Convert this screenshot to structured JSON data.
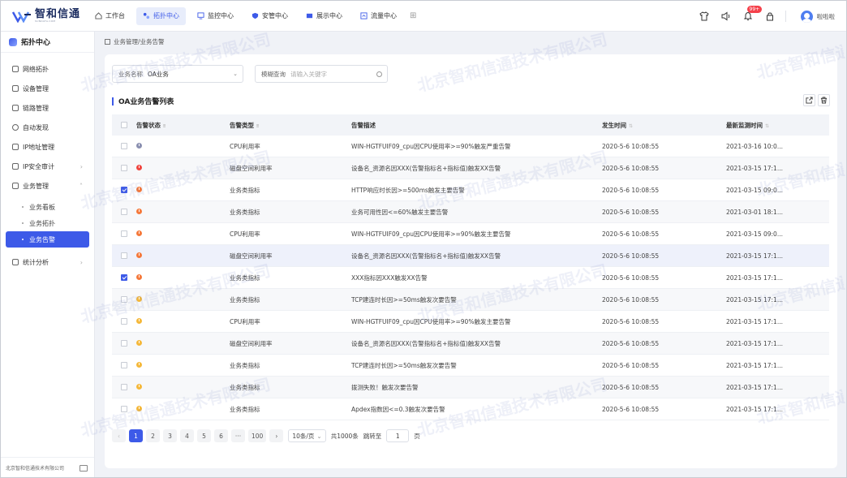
{
  "brand": {
    "name": "智和信通",
    "subtitle": "SUNDATA.COM"
  },
  "nav": [
    {
      "label": "工作台",
      "active": false
    },
    {
      "label": "拓扑中心",
      "active": true
    },
    {
      "label": "监控中心",
      "active": false
    },
    {
      "label": "安管中心",
      "active": false
    },
    {
      "label": "展示中心",
      "active": false
    },
    {
      "label": "流量中心",
      "active": false
    }
  ],
  "header": {
    "notification_count": "99+",
    "user_name": "啦啦啦"
  },
  "sidebar": {
    "title": "拓扑中心",
    "items": [
      {
        "label": "网络拓扑"
      },
      {
        "label": "设备管理"
      },
      {
        "label": "链路管理"
      },
      {
        "label": "自动发现"
      },
      {
        "label": "IP地址管理"
      },
      {
        "label": "IP安全审计"
      },
      {
        "label": "业务管理"
      }
    ],
    "subitems": [
      {
        "label": "业务看板",
        "active": false
      },
      {
        "label": "业务拓扑",
        "active": false
      },
      {
        "label": "业务告警",
        "active": true
      }
    ],
    "after": {
      "label": "统计分析"
    },
    "footer": "北京智和信通技术有限公司"
  },
  "breadcrumb": "业务管理/业务告警",
  "filters": {
    "biz_label": "业务名称",
    "biz_value": "OA业务",
    "search_label": "模糊查询",
    "search_placeholder": "请输入关键字"
  },
  "section_title": "OA业务告警列表",
  "table": {
    "headers": [
      "告警状态",
      "告警类型",
      "告警描述",
      "发生时间",
      "最新监测时间"
    ],
    "rows": [
      {
        "checked": false,
        "sev": "#8a8fb0",
        "type": "CPU利用率",
        "desc": "WIN-HGTFUIF09_cpu因CPU使用率>=90%触发严重告警",
        "time": "2020-5-6 10:08:55",
        "latest": "2021-03-16 10:0..."
      },
      {
        "checked": false,
        "sev": "#f0453f",
        "type": "磁盘空间利用率",
        "desc": "设备名_资源名因XXX(告警指标名+指标值)触发XX告警",
        "time": "2020-5-6 10:08:55",
        "latest": "2021-03-15 17:1..."
      },
      {
        "checked": true,
        "sev": "#f5793b",
        "type": "业务类指标",
        "desc": "HTTP响应时长因>=500ms触发主要告警",
        "time": "2020-5-6 10:08:55",
        "latest": "2021-03-15 09:0..."
      },
      {
        "checked": false,
        "sev": "#f5793b",
        "type": "业务类指标",
        "desc": "业务可用性因<=60%触发主要告警",
        "time": "2020-5-6 10:08:55",
        "latest": "2021-03-01 18:1..."
      },
      {
        "checked": false,
        "sev": "#f5793b",
        "type": "CPU利用率",
        "desc": "WIN-HGTFUIF09_cpu因CPU使用率>=90%触发主要告警",
        "time": "2020-5-6 10:08:55",
        "latest": "2021-03-15 09:0..."
      },
      {
        "checked": false,
        "sev": "#f5793b",
        "type": "磁盘空间利用率",
        "desc": "设备名_资源名因XXX(告警指标名+指标值)触发XX告警",
        "time": "2020-5-6 10:08:55",
        "latest": "2021-03-15 17:1..."
      },
      {
        "checked": true,
        "sev": "#f5793b",
        "type": "业务类指标",
        "desc": "XXX指标因XXX触发XX告警",
        "time": "2020-5-6 10:08:55",
        "latest": "2021-03-15 17:1..."
      },
      {
        "checked": false,
        "sev": "#f5b83a",
        "type": "业务类指标",
        "desc": "TCP建连时长因>=50ms触发次要告警",
        "time": "2020-5-6 10:08:55",
        "latest": "2021-03-15 17:1..."
      },
      {
        "checked": false,
        "sev": "#f5b83a",
        "type": "CPU利用率",
        "desc": "WIN-HGTFUIF09_cpu因CPU使用率>=90%触发主要告警",
        "time": "2020-5-6 10:08:55",
        "latest": "2021-03-15 17:1..."
      },
      {
        "checked": false,
        "sev": "#f5b83a",
        "type": "磁盘空间利用率",
        "desc": "设备名_资源名因XXX(告警指标名+指标值)触发XX告警",
        "time": "2020-5-6 10:08:55",
        "latest": "2021-03-15 17:1..."
      },
      {
        "checked": false,
        "sev": "#f5b83a",
        "type": "业务类指标",
        "desc": "TCP建连时长因>=50ms触发次要告警",
        "time": "2020-5-6 10:08:55",
        "latest": "2021-03-15 17:1..."
      },
      {
        "checked": false,
        "sev": "#f5b83a",
        "type": "业务类指标",
        "desc": "拨测失败！触发次要告警",
        "time": "2020-5-6 10:08:55",
        "latest": "2021-03-15 17:1..."
      },
      {
        "checked": false,
        "sev": "#f5b83a",
        "type": "业务类指标",
        "desc": "Apdex指数因<=0.3触发次要告警",
        "time": "2020-5-6 10:08:55",
        "latest": "2021-03-15 17:1..."
      }
    ]
  },
  "pagination": {
    "prev": "‹",
    "pages": [
      "1",
      "2",
      "3",
      "4",
      "5",
      "6",
      "···",
      "100"
    ],
    "next": "›",
    "page_size": "10条/页",
    "total": "共1000条",
    "jump_label": "跳转至",
    "jump_value": "1",
    "page_unit": "页"
  },
  "watermark": "北京智和信通技术有限公司",
  "colors": {
    "accent": "#3d5ae8"
  }
}
